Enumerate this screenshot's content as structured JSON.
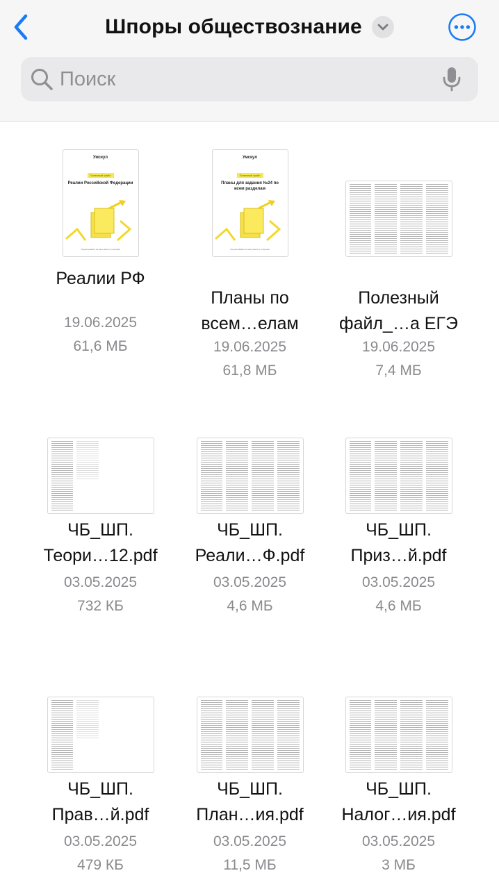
{
  "header": {
    "title": "Шпоры обществознание",
    "back_icon": "chevron-left-icon",
    "title_menu_icon": "chevron-down-icon",
    "more_icon": "ellipsis-circle-icon",
    "accent_color": "#1a7cf5"
  },
  "search": {
    "placeholder": "Поиск",
    "value": "",
    "search_icon": "magnifier-icon",
    "mic_icon": "microphone-icon"
  },
  "files": [
    {
      "name_line1": "Реалии РФ",
      "name_line2": "",
      "date": "19.06.2025",
      "size": "61,6 МБ",
      "thumb": "portrait",
      "cover": {
        "logo": "Умскул",
        "tag": "Полезный файл",
        "title": "Реалии Российской Федерации",
        "footer": "Подписывайся на наш канал в телеграм"
      }
    },
    {
      "name_line1": "Планы по",
      "name_line2": "всем…елам",
      "date": "19.06.2025",
      "size": "61,8 МБ",
      "thumb": "portrait",
      "cover": {
        "logo": "Умскул",
        "tag": "Полезный файл",
        "title": "Планы для задания №24 по всем разделам",
        "footer": "Подписывайся на наш канал в телеграм"
      }
    },
    {
      "name_line1": "Полезный",
      "name_line2": "файл_…а ЕГЭ",
      "date": "19.06.2025",
      "size": "7,4 МБ",
      "thumb": "landscape"
    },
    {
      "name_line1": "ЧБ_ШП.",
      "name_line2": "Теори…12.pdf",
      "date": "03.05.2025",
      "size": "732 КБ",
      "thumb": "landscape"
    },
    {
      "name_line1": "ЧБ_ШП.",
      "name_line2": "Реали…Ф.pdf",
      "date": "03.05.2025",
      "size": "4,6 МБ",
      "thumb": "landscape"
    },
    {
      "name_line1": "ЧБ_ШП.",
      "name_line2": "Приз…й.pdf",
      "date": "03.05.2025",
      "size": "4,6 МБ",
      "thumb": "landscape"
    },
    {
      "name_line1": "ЧБ_ШП.",
      "name_line2": "Прав…й.pdf",
      "date": "03.05.2025",
      "size": "479 КБ",
      "thumb": "landscape"
    },
    {
      "name_line1": "ЧБ_ШП.",
      "name_line2": "План…ия.pdf",
      "date": "03.05.2025",
      "size": "11,5 МБ",
      "thumb": "landscape"
    },
    {
      "name_line1": "ЧБ_ШП.",
      "name_line2": "Налог…ия.pdf",
      "date": "03.05.2025",
      "size": "3 МБ",
      "thumb": "landscape"
    }
  ]
}
